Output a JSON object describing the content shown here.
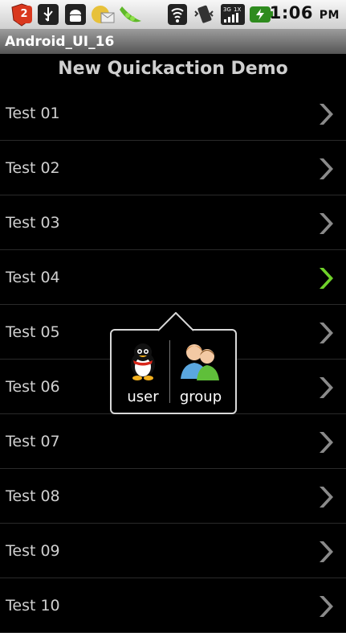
{
  "status_bar": {
    "notification_count": "2",
    "time": "1:06",
    "ampm": "PM",
    "icons": [
      "usb-icon",
      "android-debug-icon",
      "email-icon",
      "pea-pod-icon",
      "wifi-icon",
      "vibrate-icon",
      "signal-3g-icon",
      "battery-charging-icon"
    ]
  },
  "app": {
    "title": "Android_UI_16"
  },
  "header": {
    "title": "New Quickaction Demo"
  },
  "list": {
    "items": [
      {
        "label": "Test 01"
      },
      {
        "label": "Test 02"
      },
      {
        "label": "Test 03"
      },
      {
        "label": "Test 04"
      },
      {
        "label": "Test 05"
      },
      {
        "label": "Test 06"
      },
      {
        "label": "Test 07"
      },
      {
        "label": "Test 08"
      },
      {
        "label": "Test 09"
      },
      {
        "label": "Test 10"
      }
    ],
    "selected_index": 3
  },
  "quick_action": {
    "actions": [
      {
        "label": "user",
        "icon": "penguin-user-icon"
      },
      {
        "label": "group",
        "icon": "group-icon"
      }
    ]
  },
  "colors": {
    "chevron": "#8a8a8a",
    "chevron_selected": "#6fd12a",
    "text": "#cfcfcf",
    "background": "#000000"
  }
}
